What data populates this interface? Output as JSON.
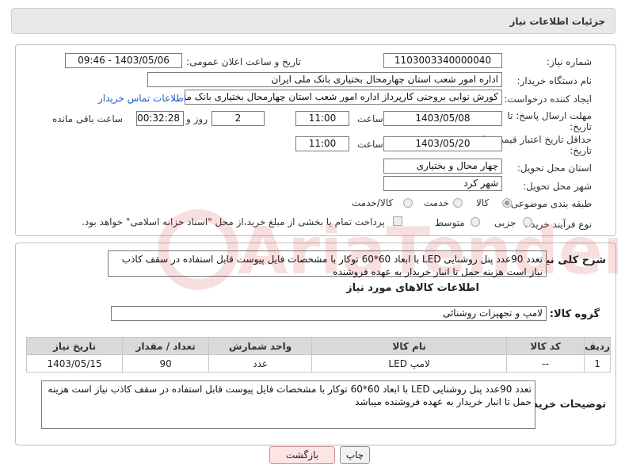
{
  "header": {
    "title": "جزئیات اطلاعات نیاز"
  },
  "info": {
    "need_number_label": "شماره نیاز:",
    "need_number": "1103003340000040",
    "announce_label": "تاریخ و ساعت اعلان عمومی:",
    "announce_value": "1403/05/06 - 09:46",
    "buyer_org_label": "نام دستگاه خریدار:",
    "buyer_org": "اداره امور شعب استان چهارمحال بختیاری بانک ملی ایران",
    "creator_label": "ایجاد کننده درخواست:",
    "creator": "کورش نوابی بروجنی کارپرداز اداره امور شعب استان چهارمحال بختیاری بانک ملی",
    "contact_link": "اطلاعات تماس خریدار",
    "reply_deadline_label_1": "مهلت ارسال پاسخ: تا",
    "reply_deadline_label_2": "تاریخ:",
    "reply_date": "1403/05/08",
    "time_label": "ساعت",
    "reply_time": "11:00",
    "days_value": "2",
    "days_label": "روز و",
    "remaining_time": "00:32:28",
    "remaining_label": "ساعت باقی مانده",
    "validity_label_1": "حداقل تاریخ اعتبار قیمت: تا",
    "validity_label_2": "تاریخ:",
    "validity_date": "1403/05/20",
    "validity_time": "11:00",
    "province_label": "استان محل تحویل:",
    "province": "چهار محال و بختیاری",
    "city_label": "شهر محل تحویل:",
    "city": "شهر کرد",
    "category_label": "طبقه بندی موضوعی:",
    "category_options": [
      "کالا",
      "خدمت",
      "کالا/خدمت"
    ],
    "process_label": "نوع فرآیند خرید :",
    "process_options": [
      "جزیی",
      "متوسط"
    ],
    "payment_note": "پرداخت تمام یا بخشی از مبلغ خرید،از محل \"اسناد خزانه اسلامی\" خواهد بود."
  },
  "goods": {
    "summary_label": "شرح کلی نیاز:",
    "summary": "تعدد 90عدد پنل روشنایی LED با ابعاد 60*60 توکار با مشخصات فایل پیوست قابل استفاده در سقف کاذب نیاز است هزینه حمل تا انبار خریدار به عهده فروشنده",
    "section_title": "اطلاعات کالاهای مورد نیاز",
    "group_label": "گروه کالا:",
    "group": "لامپ و تجهیزات روشنائی",
    "table": {
      "headers": [
        "ردیف",
        "کد کالا",
        "نام کالا",
        "واحد شمارش",
        "تعداد / مقدار",
        "تاریخ نیاز"
      ],
      "rows": [
        [
          "1",
          "--",
          "لامپ LED",
          "عدد",
          "90",
          "1403/05/15"
        ]
      ]
    },
    "buyer_notes_label": "توضیحات خریدار:",
    "buyer_notes": "تعدد 90عدد پنل روشنایی LED با ابعاد 60*60 توکار با مشخصات فایل پیوست قابل استفاده در سقف کاذب نیاز است هزینه حمل تا انبار خریدار به عهده فروشنده میباشد"
  },
  "buttons": {
    "print": "چاپ",
    "back": "بازگشت"
  },
  "watermark_text": "AriaTender.neT"
}
